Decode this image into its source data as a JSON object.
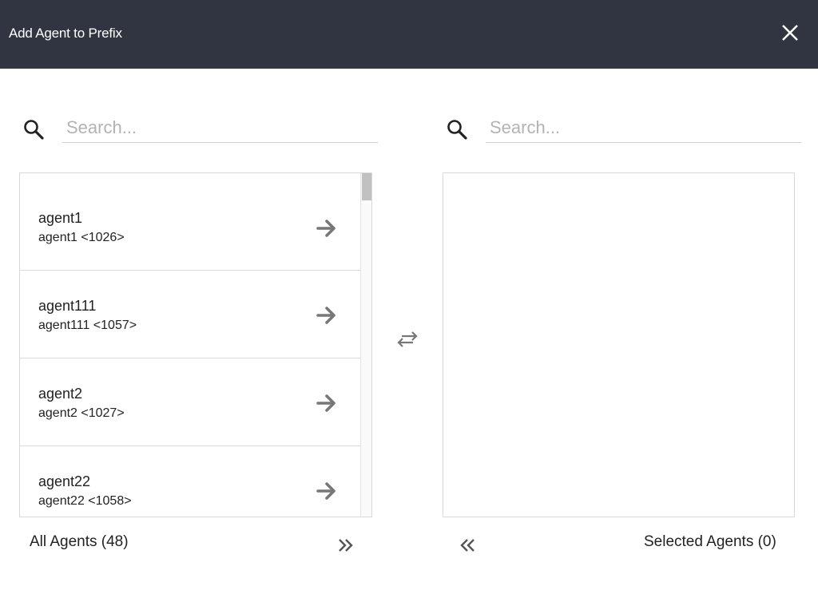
{
  "header": {
    "title": "Add Agent to Prefix",
    "close_icon": "close-icon"
  },
  "left": {
    "search_placeholder": "Search...",
    "items": [
      {
        "name": "agent1",
        "detail": "agent1 <1026>"
      },
      {
        "name": "agent111",
        "detail": "agent111 <1057>"
      },
      {
        "name": "agent2",
        "detail": "agent2 <1027>"
      },
      {
        "name": "agent22",
        "detail": "agent22 <1058>"
      }
    ],
    "footer_label": "All Agents (48)"
  },
  "right": {
    "search_placeholder": "Search...",
    "footer_label": "Selected Agents (0)"
  },
  "colors": {
    "header_bg": "#303541",
    "icon": "#777777",
    "border": "#d8d8d8"
  }
}
